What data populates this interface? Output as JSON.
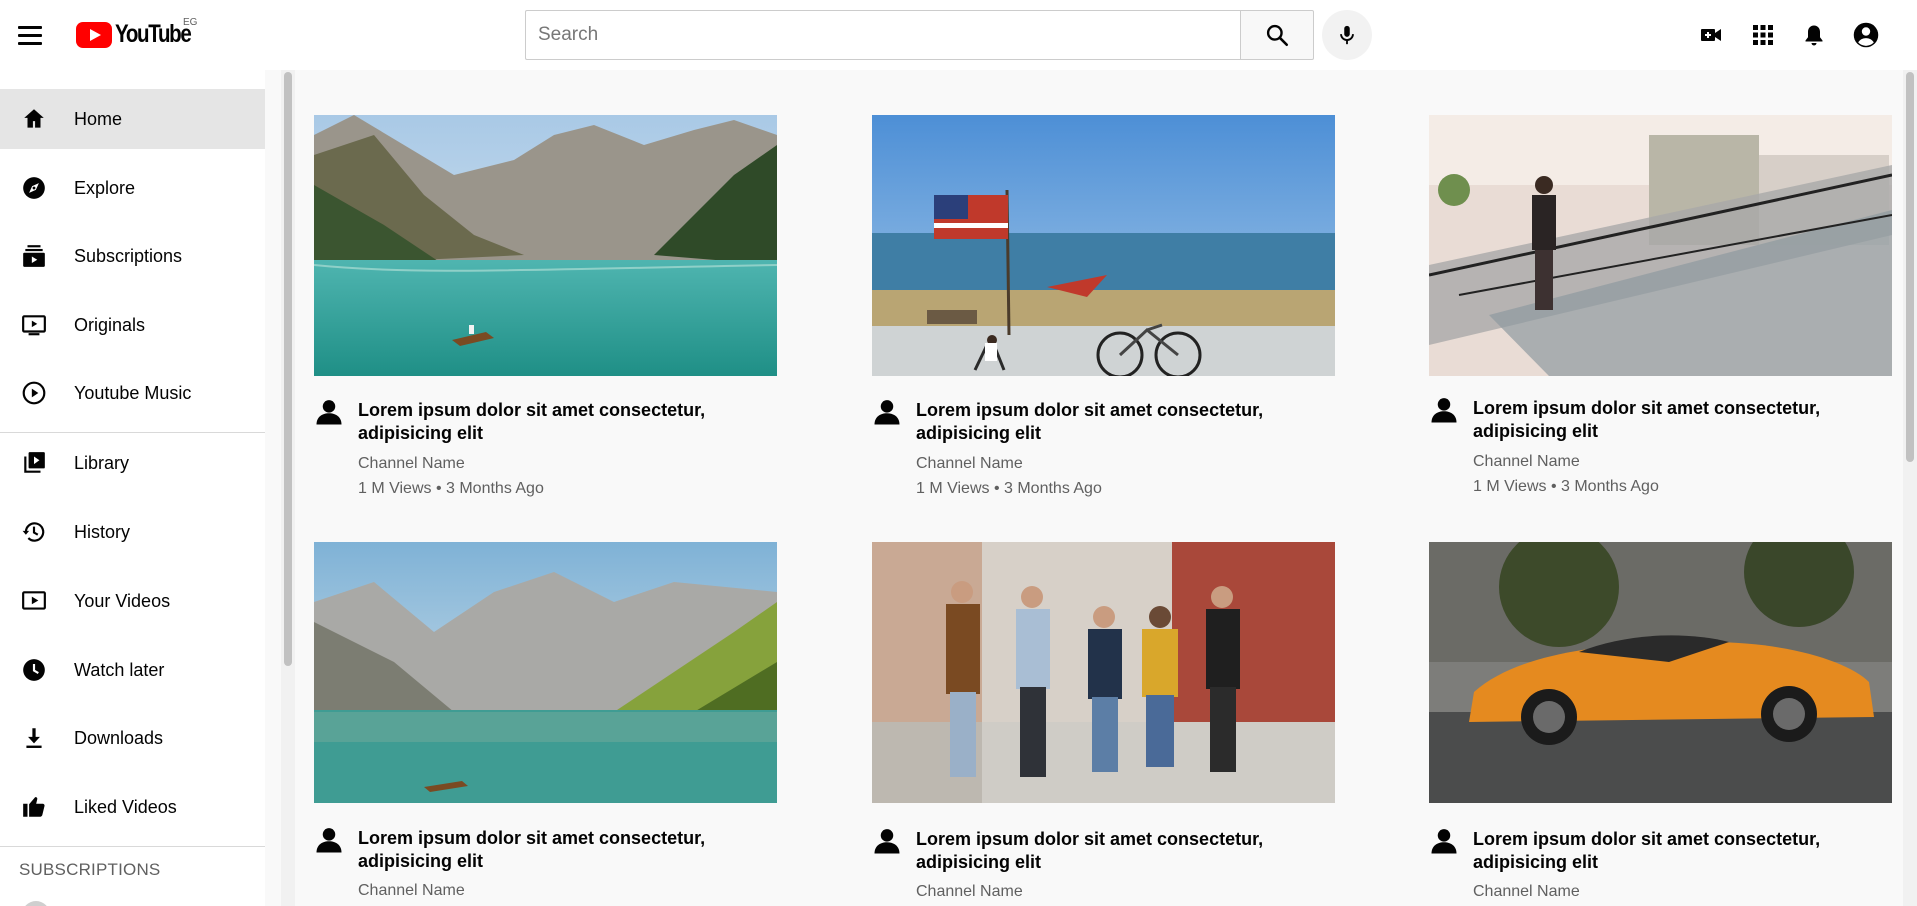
{
  "header": {
    "logo_text": "YouTube",
    "region": "EG",
    "search_placeholder": "Search"
  },
  "sidebar": {
    "items": [
      {
        "label": "Home",
        "icon": "home-icon",
        "active": true
      },
      {
        "label": "Explore",
        "icon": "compass-icon"
      },
      {
        "label": "Subscriptions",
        "icon": "subscriptions-icon"
      },
      {
        "label": "Originals",
        "icon": "originals-icon"
      },
      {
        "label": "Youtube Music",
        "icon": "music-play-icon"
      },
      {
        "label": "Library",
        "icon": "library-icon"
      },
      {
        "label": "History",
        "icon": "history-icon"
      },
      {
        "label": "Your Videos",
        "icon": "your-videos-icon"
      },
      {
        "label": "Watch later",
        "icon": "clock-icon"
      },
      {
        "label": "Downloads",
        "icon": "download-icon"
      },
      {
        "label": "Liked Videos",
        "icon": "thumbs-up-icon"
      }
    ],
    "section_title": "SUBSCRIPTIONS"
  },
  "videos": [
    {
      "title": "Lorem ipsum dolor sit amet consectetur, adipisicing elit",
      "channel": "Channel Name",
      "meta": "1 M Views • 3 Months Ago",
      "thumbnail": "mountain-lake-boat"
    },
    {
      "title": "Lorem ipsum dolor sit amet consectetur, adipisicing elit",
      "channel": "Channel Name",
      "meta": "1 M Views • 3 Months Ago",
      "thumbnail": "beach-flag-bike"
    },
    {
      "title": "Lorem ipsum dolor sit amet consectetur, adipisicing elit",
      "channel": "Channel Name",
      "meta": "1 M Views • 3 Months Ago",
      "thumbnail": "mall-escalator"
    },
    {
      "title": "Lorem ipsum dolor sit amet consectetur, adipisicing elit",
      "channel": "Channel Name",
      "meta": "",
      "thumbnail": "alpine-lake"
    },
    {
      "title": "Lorem ipsum dolor sit amet consectetur, adipisicing elit",
      "channel": "Channel Name",
      "meta": "",
      "thumbnail": "friends-walking"
    },
    {
      "title": "Lorem ipsum dolor sit amet consectetur, adipisicing elit",
      "channel": "Channel Name",
      "meta": "",
      "thumbnail": "orange-sports-car"
    }
  ],
  "colors": {
    "brand": "#ff0000",
    "active_bg": "#e5e5e5",
    "page_bg": "#f9f9f9"
  }
}
